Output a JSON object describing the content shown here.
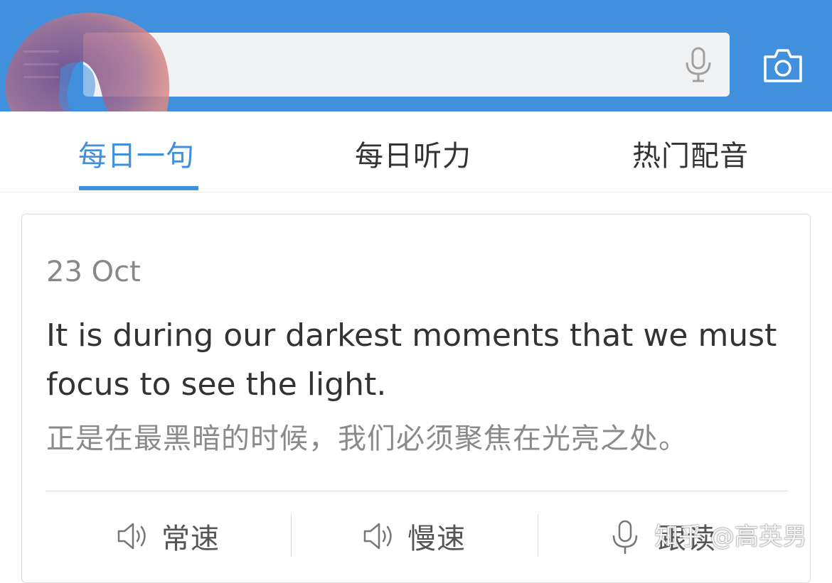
{
  "header": {
    "search": {
      "value": "",
      "placeholder": ""
    },
    "colors": {
      "bar": "#4190DD",
      "accent": "#4190DD"
    },
    "icons": [
      "menu-icon",
      "microphone-icon",
      "camera-icon"
    ]
  },
  "tabs": [
    {
      "label": "每日一句",
      "active": true
    },
    {
      "label": "每日听力",
      "active": false
    },
    {
      "label": "热门配音",
      "active": false
    }
  ],
  "card": {
    "date": "23 Oct",
    "sentence_en": "It is during our darkest moments that we must focus to see the light.",
    "sentence_zh": "正是在最黑暗的时候，我们必须聚焦在光亮之处。",
    "actions": [
      {
        "label": "常速",
        "icon": "speaker-icon"
      },
      {
        "label": "慢速",
        "icon": "speaker-icon"
      },
      {
        "label": "跟读",
        "icon": "microphone-icon"
      }
    ]
  },
  "watermark": "知乎 @高英男"
}
